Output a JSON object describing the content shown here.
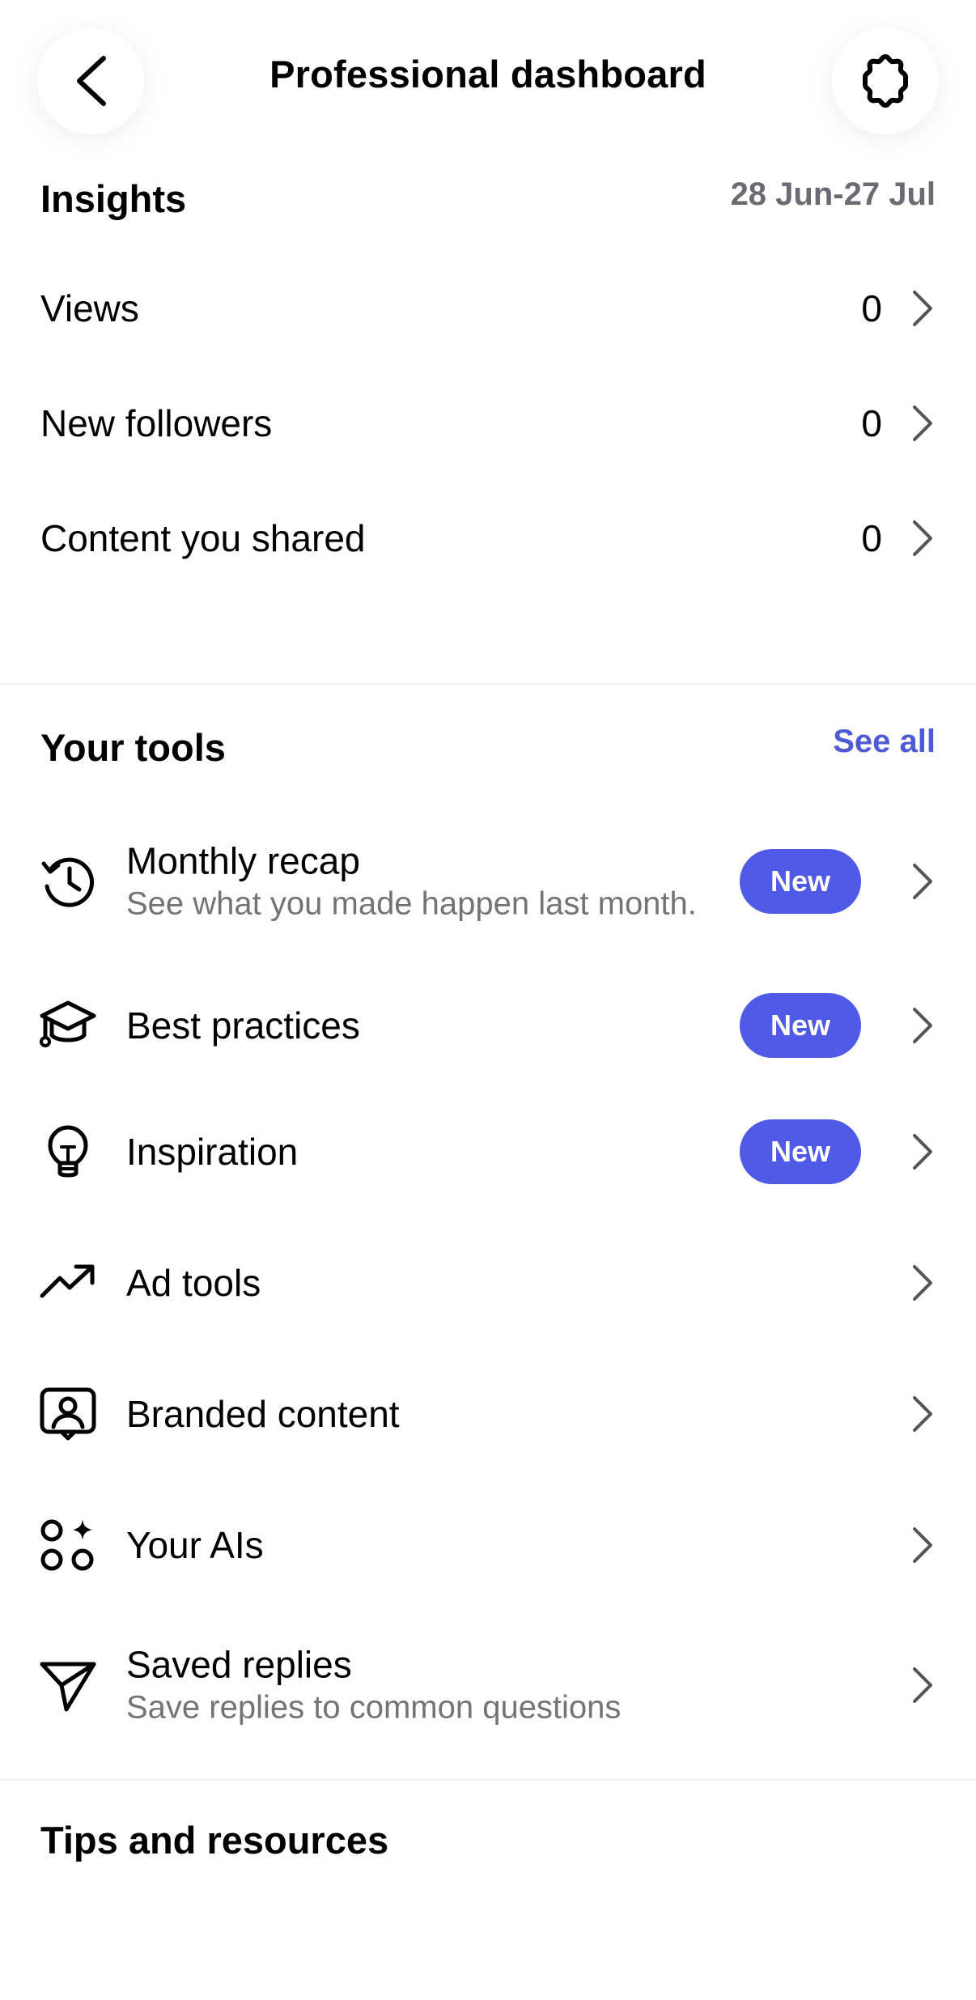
{
  "header": {
    "title": "Professional dashboard",
    "back_icon": "chevron-left-icon",
    "settings_icon": "gear-icon"
  },
  "insights": {
    "title": "Insights",
    "date_range": "28 Jun-27 Jul",
    "rows": [
      {
        "label": "Views",
        "value": "0"
      },
      {
        "label": "New followers",
        "value": "0"
      },
      {
        "label": "Content you shared",
        "value": "0"
      }
    ]
  },
  "tools": {
    "title": "Your tools",
    "see_all": "See all",
    "items": [
      {
        "label": "Monthly recap",
        "sub": "See what you made happen last month.",
        "badge": "New",
        "icon": "history-icon"
      },
      {
        "label": "Best practices",
        "badge": "New",
        "icon": "graduation-cap-icon"
      },
      {
        "label": "Inspiration",
        "badge": "New",
        "icon": "lightbulb-icon"
      },
      {
        "label": "Ad tools",
        "icon": "trending-up-icon"
      },
      {
        "label": "Branded content",
        "icon": "portrait-badge-icon"
      },
      {
        "label": "Your AIs",
        "icon": "ai-shapes-icon"
      },
      {
        "label": "Saved replies",
        "sub": "Save replies to common questions",
        "icon": "paper-plane-icon"
      }
    ]
  },
  "tips": {
    "title": "Tips and resources"
  },
  "colors": {
    "accent": "#4f5bd5",
    "badge_bg": "#4f5ae6",
    "muted_text": "#737378",
    "divider": "#efefef"
  }
}
